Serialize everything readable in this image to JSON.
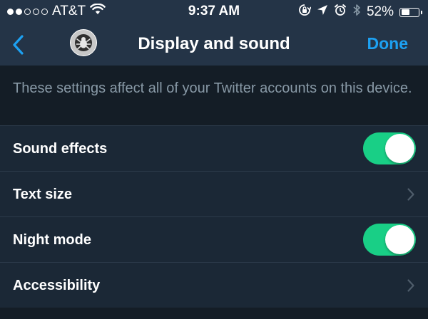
{
  "status_bar": {
    "signal_filled": 2,
    "signal_total": 5,
    "carrier": "AT&T",
    "time": "9:37 AM",
    "battery_percent": "52%",
    "battery_level": 0.52,
    "icons": [
      "wifi-icon",
      "orientation-lock-icon",
      "location-arrow-icon",
      "alarm-clock-icon",
      "bluetooth-icon",
      "battery-icon"
    ]
  },
  "nav": {
    "title": "Display and sound",
    "done_label": "Done",
    "back_icon": "chevron-left-icon",
    "avatar_icon": "user-avatar"
  },
  "info_text": "These settings affect all of your Twitter accounts on this device.",
  "settings": {
    "sound_effects": {
      "label": "Sound effects",
      "enabled": true
    },
    "text_size": {
      "label": "Text size"
    },
    "night_mode": {
      "label": "Night mode",
      "enabled": true
    },
    "accessibility": {
      "label": "Accessibility"
    }
  },
  "colors": {
    "background": "#1b2836",
    "bar": "#243447",
    "info_background": "#141d26",
    "accent": "#1da1f2",
    "toggle_on": "#19cf86",
    "secondary_text": "#8899a6"
  }
}
